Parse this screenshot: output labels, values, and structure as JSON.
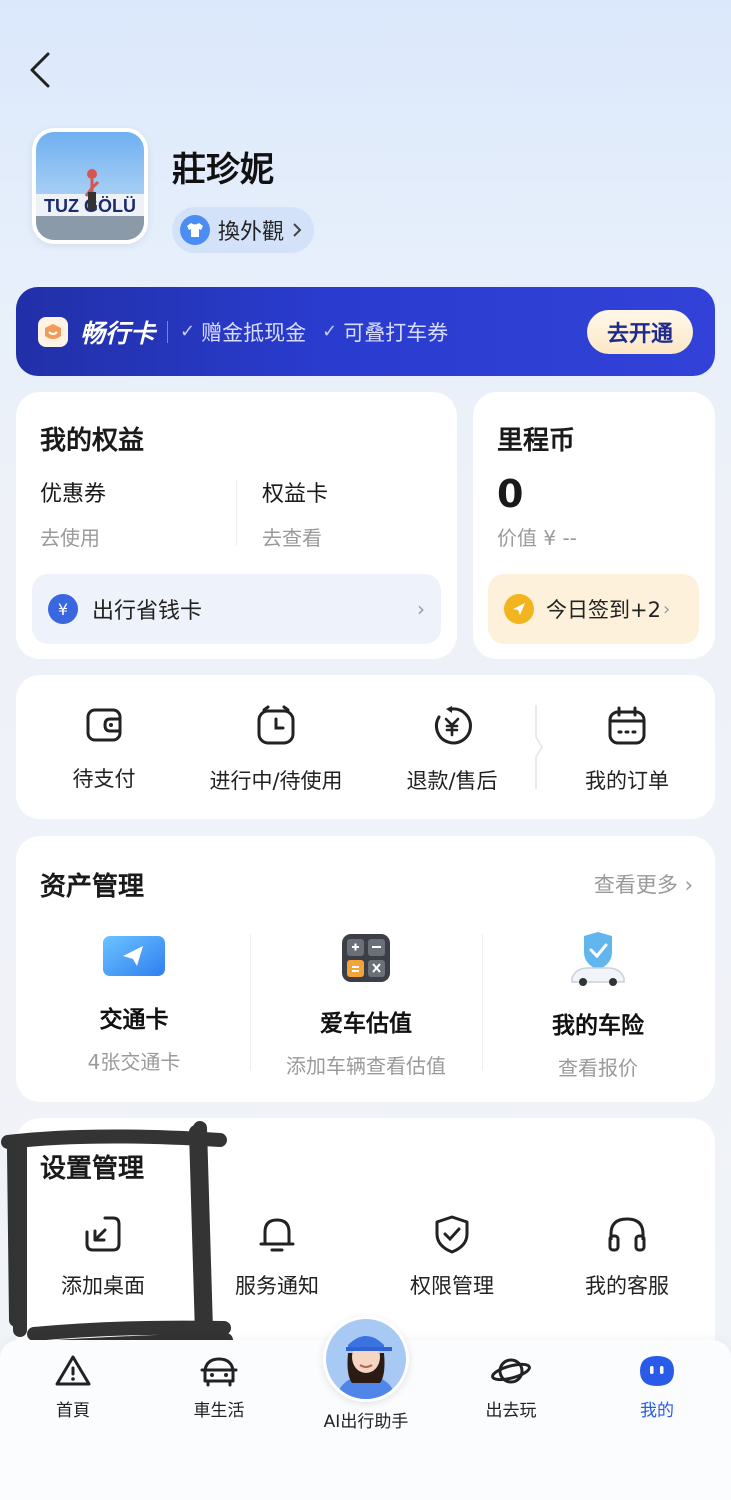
{
  "profile": {
    "name": "莊珍妮",
    "skin_label": "換外觀",
    "avatar_text": "TUZ GÖLÜ"
  },
  "vip": {
    "title": "畅行卡",
    "features": [
      "赠金抵现金",
      "可叠打车券"
    ],
    "open_label": "去开通"
  },
  "benefits": {
    "title": "我的权益",
    "coupon_title": "优惠券",
    "coupon_desc": "去使用",
    "card_title": "权益卡",
    "card_desc": "去查看",
    "save_card_label": "出行省钱卡",
    "save_card_icon": "¥"
  },
  "mileage": {
    "title": "里程币",
    "value": "0",
    "worth": "价值 ¥ --",
    "checkin_label": "今日签到+2"
  },
  "orders": {
    "items": [
      "待支付",
      "进行中/待使用",
      "退款/售后",
      "我的订单"
    ]
  },
  "assets": {
    "title": "资产管理",
    "more_label": "查看更多",
    "items": [
      {
        "name": "交通卡",
        "desc": "4张交通卡"
      },
      {
        "name": "爱车估值",
        "desc": "添加车辆查看估值"
      },
      {
        "name": "我的车险",
        "desc": "查看报价"
      }
    ]
  },
  "settings": {
    "title": "设置管理",
    "items": [
      "添加桌面",
      "服务通知",
      "权限管理",
      "我的客服"
    ]
  },
  "tabbar": {
    "items": [
      "首頁",
      "車生活",
      "AI出行助手",
      "出去玩",
      "我的"
    ],
    "active": "我的"
  },
  "colors": {
    "accent": "#2a5be8",
    "banner": "#2a3ccf",
    "checkin_bg": "#fdf1dc"
  }
}
